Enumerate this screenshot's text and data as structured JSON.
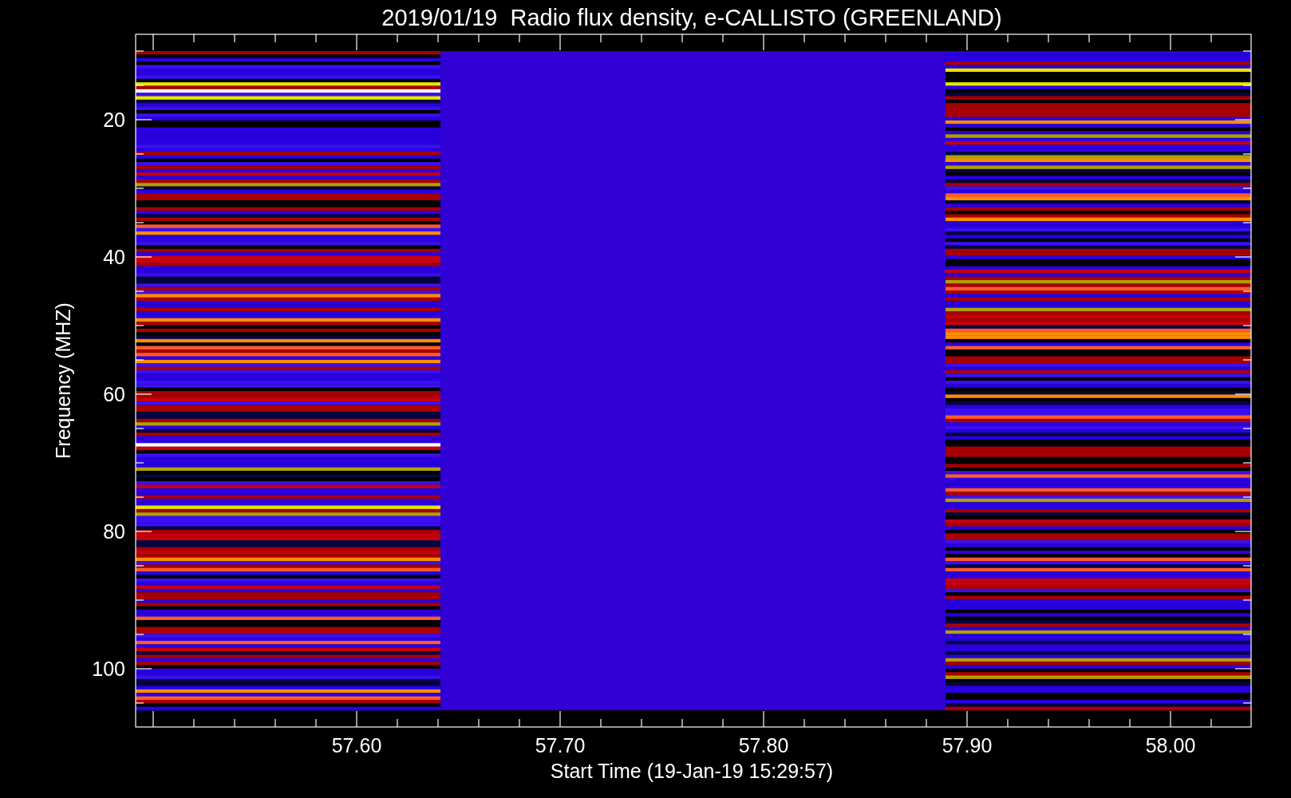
{
  "title": "2019/01/19  Radio flux density, e-CALLISTO (GREENLAND)",
  "plot": {
    "x_axis_label": "Start Time (19-Jan-19 15:29:57)",
    "y_axis_label": "Frequency (MHZ)",
    "x_tick_labels": [
      "57.60",
      "57.70",
      "57.80",
      "57.90",
      "58.00"
    ],
    "y_tick_labels": [
      "20",
      "40",
      "60",
      "80",
      "100"
    ]
  }
}
